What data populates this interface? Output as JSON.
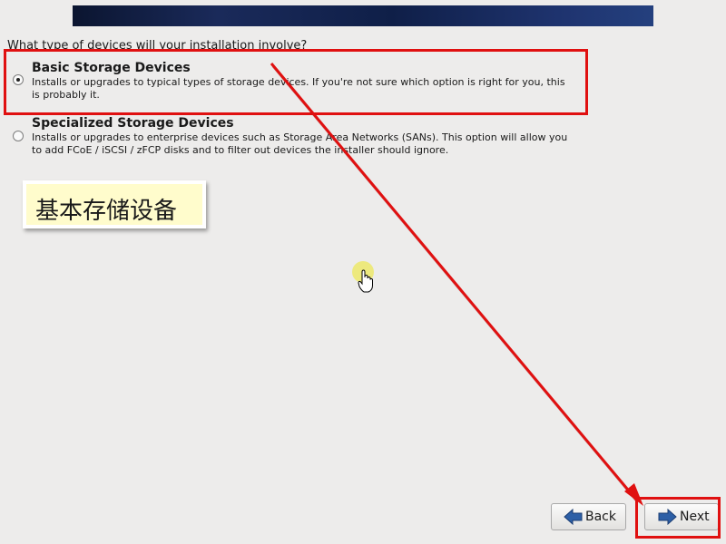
{
  "question": "What type of devices will your installation involve?",
  "options": [
    {
      "title": "Basic Storage Devices",
      "description": "Installs or upgrades to typical types of storage devices.  If you're not sure which option is right for you, this is probably it.",
      "selected": true
    },
    {
      "title": "Specialized Storage Devices",
      "description": "Installs or upgrades to enterprise devices such as Storage Area Networks (SANs). This option will allow you to add FCoE / iSCSI / zFCP disks and to filter out devices the installer should ignore.",
      "selected": false
    }
  ],
  "annotation": {
    "callout_text": "基本存储设备",
    "highlight_color": "#e01010"
  },
  "buttons": {
    "back_label": "Back",
    "next_label": "Next",
    "back_icon": "arrow-left-icon",
    "next_icon": "arrow-right-icon"
  },
  "colors": {
    "background": "#edeceb",
    "banner": "#0f1f48",
    "button_icon": "#2d5fa6"
  }
}
